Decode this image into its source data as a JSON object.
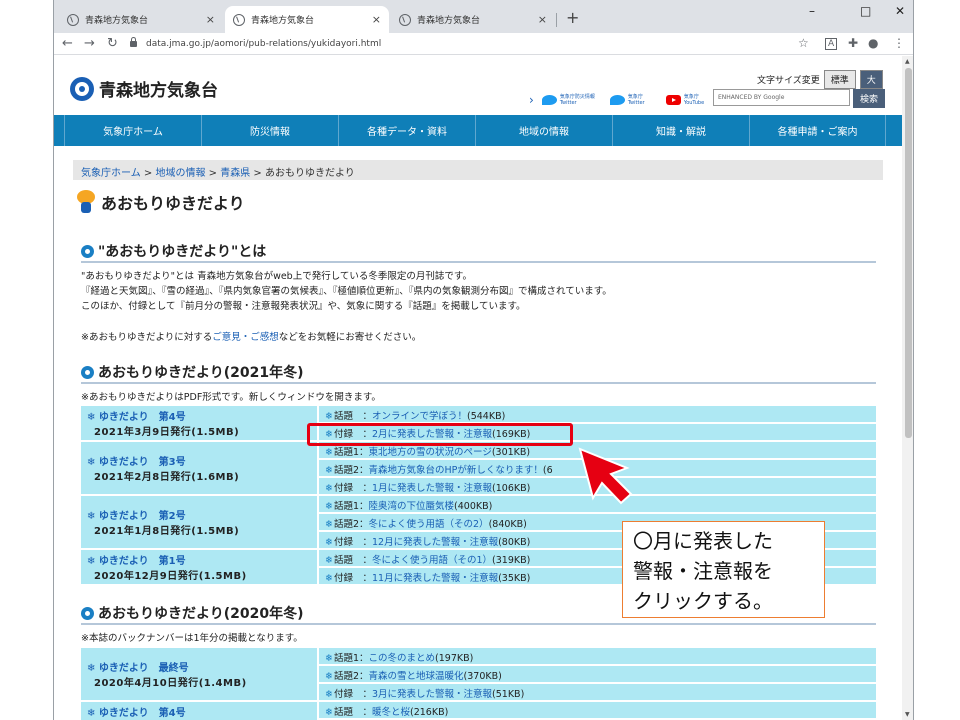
{
  "browser": {
    "tabs": [
      {
        "title": "青森地方気象台",
        "close": "×"
      },
      {
        "title": "青森地方気象台",
        "close": "×"
      },
      {
        "title": "青森地方気象台",
        "close": "×"
      }
    ],
    "new_tab": "+",
    "window_controls": [
      "–",
      "□",
      "✕"
    ],
    "url": "data.jma.go.jp/aomori/pub-relations/yukidayori.html",
    "nav": {
      "back": "←",
      "forward": "→",
      "reload": "↻"
    }
  },
  "site": {
    "name": "青森地方気象台",
    "fontsize_label": "文字サイズ変更",
    "fontsize_standard": "標準",
    "fontsize_large": "大",
    "social": [
      {
        "label": "気象庁防災情報 Twitter"
      },
      {
        "label": "気象庁 Twitter"
      },
      {
        "label": "気象庁 YouTube"
      }
    ],
    "search_placeholder": "ENHANCED BY Google",
    "search_button": "検索"
  },
  "gnav": [
    "気象庁ホーム",
    "防災情報",
    "各種データ・資料",
    "地域の情報",
    "知識・解説",
    "各種申請・ご案内"
  ],
  "breadcrumb": {
    "items": [
      "気象庁ホーム",
      "地域の情報",
      "青森県"
    ],
    "sep": " > ",
    "current": "あおもりゆきだより"
  },
  "page_title": "あおもりゆきだより",
  "about": {
    "heading": "\"あおもりゆきだより\"とは",
    "lines": [
      "\"あおもりゆきだより\"とは 青森地方気象台がweb上で発行している冬季限定の月刊誌です。",
      "『経過と天気図』、『雪の経過』、『県内気象官署の気候表』、『極値順位更新』、『県内の気象観測分布図』で構成されています。",
      "このほか、付録として『前月分の警報・注意報発表状況』や、気象に関する『話題』を掲載しています。"
    ],
    "feedback_pre": "※あおもりゆきだよりに対する",
    "feedback_link": "ご意見・ご感想",
    "feedback_post": "などをお気軽にお寄せください。"
  },
  "section_2021": {
    "heading": "あおもりゆきだより(2021年冬)",
    "note": "※あおもりゆきだよりはPDF形式です。新しくウィンドウを開きます。",
    "issues": [
      {
        "name": "ゆきだより　第4号",
        "date": "2021年3月9日発行(1.5MB)",
        "items": [
          {
            "label": "話題　：",
            "link": "オンラインで学ぼう！",
            "size": "(544KB)"
          },
          {
            "label": "付録　：",
            "link": "2月に発表した警報・注意報",
            "size": "(169KB)"
          }
        ]
      },
      {
        "name": "ゆきだより　第3号",
        "date": "2021年2月8日発行(1.6MB)",
        "items": [
          {
            "label": "話題1：",
            "link": "東北地方の雪の状況のページ",
            "size": "(301KB)"
          },
          {
            "label": "話題2：",
            "link": "青森地方気象台のHPが新しくなります！",
            "size": "(6"
          },
          {
            "label": "付録　：",
            "link": "1月に発表した警報・注意報",
            "size": "(106KB)"
          }
        ]
      },
      {
        "name": "ゆきだより　第2号",
        "date": "2021年1月8日発行(1.5MB)",
        "items": [
          {
            "label": "話題1：",
            "link": "陸奥湾の下位蜃気楼",
            "size": "(400KB)"
          },
          {
            "label": "話題2：",
            "link": "冬によく使う用語（その2）",
            "size": "(840KB)"
          },
          {
            "label": "付録　：",
            "link": "12月に発表した警報・注意報",
            "size": "(80KB)"
          }
        ]
      },
      {
        "name": "ゆきだより　第1号",
        "date": "2020年12月9日発行(1.5MB)",
        "items": [
          {
            "label": "話題　：",
            "link": "冬によく使う用語（その1）",
            "size": "(319KB)"
          },
          {
            "label": "付録　：",
            "link": "11月に発表した警報・注意報",
            "size": "(35KB)"
          }
        ]
      }
    ]
  },
  "section_2020": {
    "heading": "あおもりゆきだより(2020年冬)",
    "note": "※本誌のバックナンバーは1年分の掲載となります。",
    "issues": [
      {
        "name": "ゆきだより　最終号",
        "date": "2020年4月10日発行(1.4MB)",
        "items": [
          {
            "label": "話題1：",
            "link": "この冬のまとめ",
            "size": "(197KB)"
          },
          {
            "label": "話題2：",
            "link": "青森の雪と地球温暖化",
            "size": "(370KB)"
          },
          {
            "label": "付録　：",
            "link": "3月に発表した警報・注意報",
            "size": "(51KB)"
          }
        ]
      },
      {
        "name": "ゆきだより　第4号",
        "date": "",
        "items": [
          {
            "label": "話題　：",
            "link": "暖冬と桜",
            "size": "(216KB)"
          }
        ]
      }
    ]
  },
  "callout": {
    "lines": [
      "〇月に発表した",
      "警報・注意報を",
      "クリックする。"
    ]
  }
}
